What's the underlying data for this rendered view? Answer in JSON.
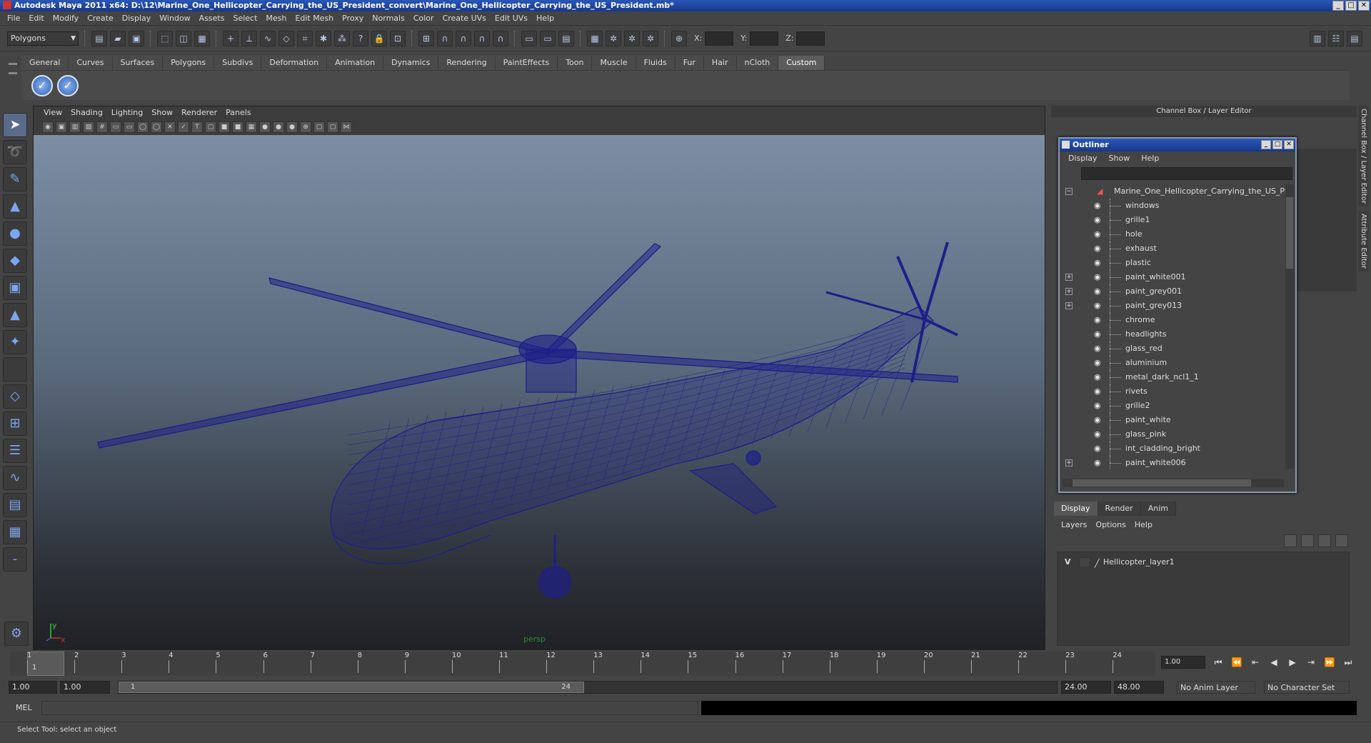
{
  "window": {
    "title": "Autodesk Maya 2011 x64: D:\\12\\Marine_One_Hellicopter_Carrying_the_US_President_convert\\Marine_One_Hellicopter_Carrying_the_US_President.mb*",
    "min": "_",
    "max": "□",
    "close": "✕"
  },
  "menubar": [
    "File",
    "Edit",
    "Modify",
    "Create",
    "Display",
    "Window",
    "Assets",
    "Select",
    "Mesh",
    "Edit Mesh",
    "Proxy",
    "Normals",
    "Color",
    "Create UVs",
    "Edit UVs",
    "Help"
  ],
  "statusline": {
    "mode": "Polygons",
    "x_label": "X:",
    "y_label": "Y:",
    "z_label": "Z:"
  },
  "shelf": {
    "tabs": [
      "General",
      "Curves",
      "Surfaces",
      "Polygons",
      "Subdivs",
      "Deformation",
      "Animation",
      "Dynamics",
      "Rendering",
      "PaintEffects",
      "Toon",
      "Muscle",
      "Fluids",
      "Fur",
      "Hair",
      "nCloth",
      "Custom"
    ],
    "active_tab": "Custom",
    "buttons": [
      "✓",
      "✓"
    ]
  },
  "viewport": {
    "menu": [
      "View",
      "Shading",
      "Lighting",
      "Show",
      "Renderer",
      "Panels"
    ],
    "camera_label": "persp",
    "axis_y": "y",
    "axis_x": "x",
    "wire_color": "#1e1e8a"
  },
  "channel_box": {
    "title": "Channel Box / Layer Editor"
  },
  "side_tabs": [
    "Channel Box / Layer Editor",
    "Attribute Editor"
  ],
  "outliner": {
    "title": "Outliner",
    "menu": [
      "Display",
      "Show",
      "Help"
    ],
    "root": "Marine_One_Hellicopter_Carrying_the_US_Presic",
    "items": [
      {
        "label": "windows",
        "expandable": false
      },
      {
        "label": "grille1",
        "expandable": false
      },
      {
        "label": "hole",
        "expandable": false
      },
      {
        "label": "exhaust",
        "expandable": false
      },
      {
        "label": "plastic",
        "expandable": false
      },
      {
        "label": "paint_white001",
        "expandable": true
      },
      {
        "label": "paint_grey001",
        "expandable": true
      },
      {
        "label": "paint_grey013",
        "expandable": true
      },
      {
        "label": "chrome",
        "expandable": false
      },
      {
        "label": "headlights",
        "expandable": false
      },
      {
        "label": "glass_red",
        "expandable": false
      },
      {
        "label": "aluminium",
        "expandable": false
      },
      {
        "label": "metal_dark_ncl1_1",
        "expandable": false
      },
      {
        "label": "rivets",
        "expandable": false
      },
      {
        "label": "grille2",
        "expandable": false
      },
      {
        "label": "paint_white",
        "expandable": false
      },
      {
        "label": "glass_pink",
        "expandable": false
      },
      {
        "label": "int_cladding_bright",
        "expandable": false
      },
      {
        "label": "paint_white006",
        "expandable": true
      }
    ]
  },
  "layer_editor": {
    "tabs": [
      "Display",
      "Render",
      "Anim"
    ],
    "active_tab": "Display",
    "menu": [
      "Layers",
      "Options",
      "Help"
    ],
    "layers": [
      {
        "visible": "V",
        "name": "Hellicopter_layer1"
      }
    ]
  },
  "timeline": {
    "ticks": [
      "1",
      "2",
      "3",
      "4",
      "5",
      "6",
      "7",
      "8",
      "9",
      "10",
      "11",
      "12",
      "13",
      "14",
      "15",
      "16",
      "17",
      "18",
      "19",
      "20",
      "21",
      "22",
      "23",
      "24"
    ],
    "current_frame_marker": "1",
    "current_time": "1.00"
  },
  "range": {
    "start_time": "1.00",
    "playback_start": "1.00",
    "range_start": "1",
    "range_end": "24",
    "playback_end": "24.00",
    "end_time": "48.00",
    "anim_layer": "No Anim Layer",
    "character_set": "No Character Set"
  },
  "command": {
    "label": "MEL"
  },
  "help_line": "Select Tool: select an object"
}
